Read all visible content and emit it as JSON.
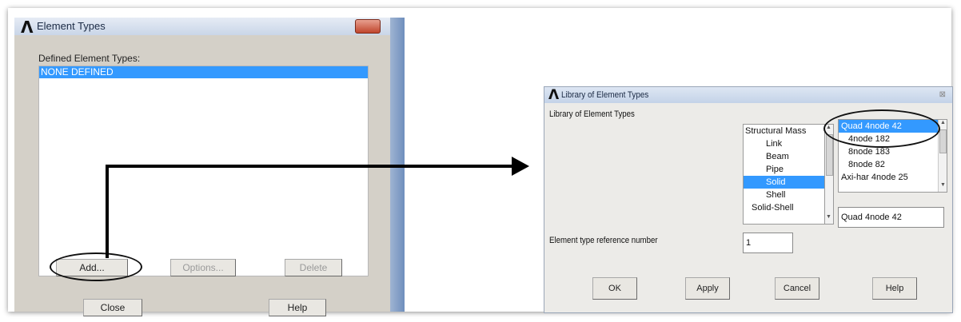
{
  "element_types_dialog": {
    "title": "Element Types",
    "defined_label": "Defined Element Types:",
    "defined_items": [
      "NONE DEFINED"
    ],
    "buttons": {
      "add": "Add...",
      "options": "Options...",
      "delete": "Delete",
      "close": "Close",
      "help": "Help"
    }
  },
  "library_dialog": {
    "title": "Library of Element Types",
    "library_label": "Library of Element Types",
    "categories": [
      "Structural Mass",
      "Link",
      "Beam",
      "Pipe",
      "Solid",
      "Shell",
      "Solid-Shell"
    ],
    "selected_category": "Solid",
    "element_options": [
      "Quad 4node   42",
      "4node  182",
      "8node  183",
      "8node  82",
      "Axi-har 4node 25"
    ],
    "selected_element": "Quad 4node   42",
    "selection_value": "Quad 4node   42",
    "ref_number_label": "Element type reference number",
    "ref_number_value": "1",
    "buttons": {
      "ok": "OK",
      "apply": "Apply",
      "cancel": "Cancel",
      "help": "Help"
    }
  },
  "colors": {
    "selection": "#3399ff",
    "dialog_bg": "#d4d0c8"
  }
}
